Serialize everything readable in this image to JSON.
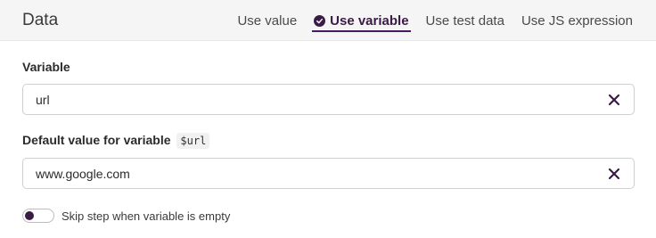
{
  "header": {
    "title": "Data",
    "tabs": [
      {
        "label": "Use value",
        "active": false
      },
      {
        "label": "Use variable",
        "active": true
      },
      {
        "label": "Use test data",
        "active": false
      },
      {
        "label": "Use JS expression",
        "active": false
      }
    ]
  },
  "variable_field": {
    "label": "Variable",
    "value": "url"
  },
  "default_field": {
    "label": "Default value for variable",
    "code": "$url",
    "value": "www.google.com"
  },
  "skip_toggle": {
    "label": "Skip step when variable is empty",
    "enabled": false
  },
  "colors": {
    "accent": "#3a1b45",
    "header_bg": "#f5f5f5"
  }
}
